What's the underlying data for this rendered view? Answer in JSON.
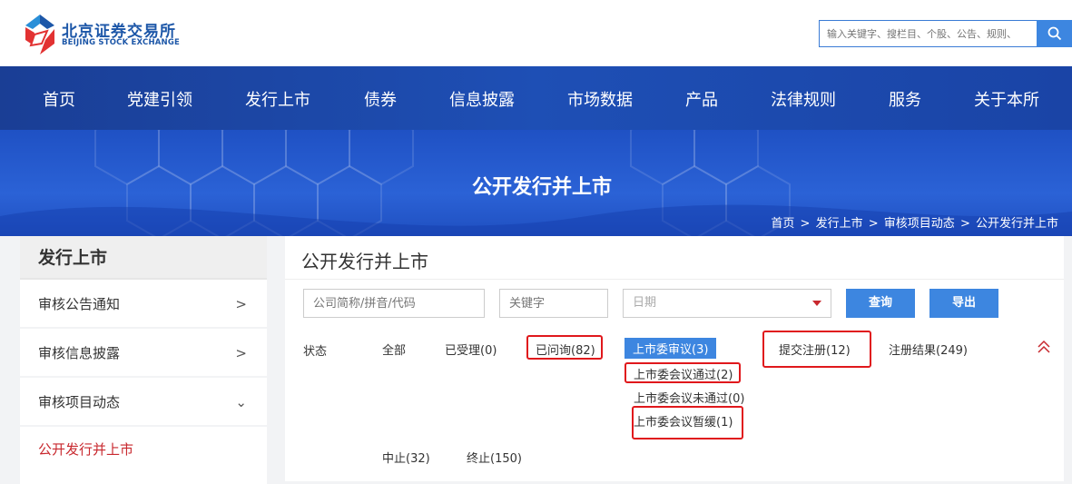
{
  "header": {
    "logo_cn": "北京证券交易所",
    "logo_en": "BEIJING STOCK EXCHANGE",
    "search_placeholder": "输入关键字、搜栏目、个股、公告、规则、"
  },
  "nav": [
    "首页",
    "党建引领",
    "发行上市",
    "债券",
    "信息披露",
    "市场数据",
    "产品",
    "法律规则",
    "服务",
    "关于本所"
  ],
  "banner": {
    "title": "公开发行并上市",
    "breadcrumb": [
      "首页",
      "发行上市",
      "审核项目动态",
      "公开发行并上市"
    ],
    "separator": ">"
  },
  "sidebar": {
    "title": "发行上市",
    "items": [
      {
        "label": "审核公告通知",
        "chevron": ">"
      },
      {
        "label": "审核信息披露",
        "chevron": ">"
      },
      {
        "label": "审核项目动态",
        "chevron": "⌄"
      }
    ],
    "active_sub": "公开发行并上市"
  },
  "main": {
    "title": "公开发行并上市",
    "company_placeholder": "公司简称/拼音/代码",
    "keyword_placeholder": "关键字",
    "date_placeholder": "日期",
    "query_label": "查询",
    "export_label": "导出",
    "status_label": "状态",
    "status_options": {
      "all": "全部",
      "accepted": "已受理(0)",
      "inquired": "已问询(82)",
      "committee": "上市委审议(3)",
      "registration": "提交注册(12)",
      "reg_result": "注册结果(249)",
      "passed": "上市委会议通过(2)",
      "not_passed": "上市委会议未通过(0)",
      "postponed": "上市委会议暂缓(1)",
      "suspended": "中止(32)",
      "terminated": "终止(150)"
    }
  },
  "colors": {
    "brand_blue": "#1d57a8",
    "nav_blue": "#1e4fb5",
    "button_blue": "#3d86e0",
    "accent_red": "#c8282e",
    "highlight_red": "#e0181c"
  }
}
